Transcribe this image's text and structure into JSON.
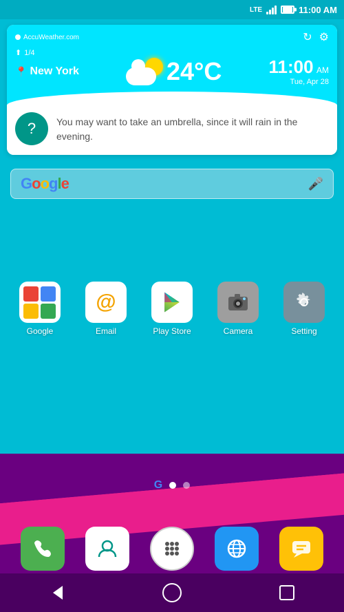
{
  "statusBar": {
    "lte": "LTE",
    "time": "11:00 AM"
  },
  "weather": {
    "source": "AccuWeather.com",
    "page": "1/4",
    "location": "New York",
    "temp": "24°C",
    "time": "11:00",
    "ampm": "AM",
    "date": "Tue, Apr 28",
    "advice": "You may want to take an umbrella, since it will rain in the evening.",
    "refreshIcon": "↻",
    "settingsIcon": "⚙"
  },
  "search": {
    "placeholder": "Google",
    "micLabel": "microphone"
  },
  "apps": [
    {
      "label": "Google",
      "type": "google"
    },
    {
      "label": "Email",
      "type": "email"
    },
    {
      "label": "Play Store",
      "type": "playstore"
    },
    {
      "label": "Camera",
      "type": "camera"
    },
    {
      "label": "Setting",
      "type": "settings"
    }
  ],
  "dock": [
    {
      "label": "Phone",
      "type": "phone"
    },
    {
      "label": "Contacts",
      "type": "contacts"
    },
    {
      "label": "Apps",
      "type": "apps"
    },
    {
      "label": "Browser",
      "type": "browser"
    },
    {
      "label": "Messages",
      "type": "messages"
    }
  ],
  "nav": {
    "back": "◁",
    "home": "○",
    "recent": "□"
  },
  "pageDots": {
    "g": "G",
    "active": 0,
    "count": 2
  }
}
